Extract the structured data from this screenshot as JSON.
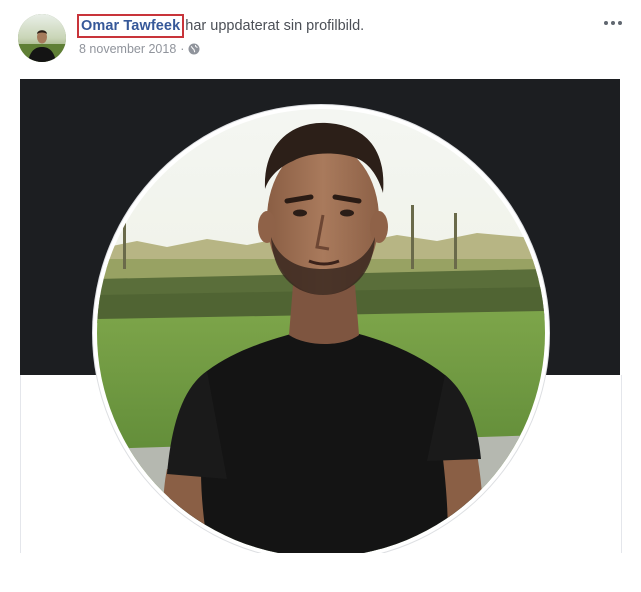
{
  "post": {
    "author_name": "Omar Tawfeek",
    "action_text": "har uppdaterat sin profilbild.",
    "date": "8 november 2018",
    "separator": "·",
    "privacy_icon": "globe-icon",
    "more_icon": "more-options-icon"
  },
  "colors": {
    "author_link": "#365899",
    "highlight_box": "#c8343a",
    "cover_background": "#1c1e21",
    "meta_text": "#90949c"
  }
}
